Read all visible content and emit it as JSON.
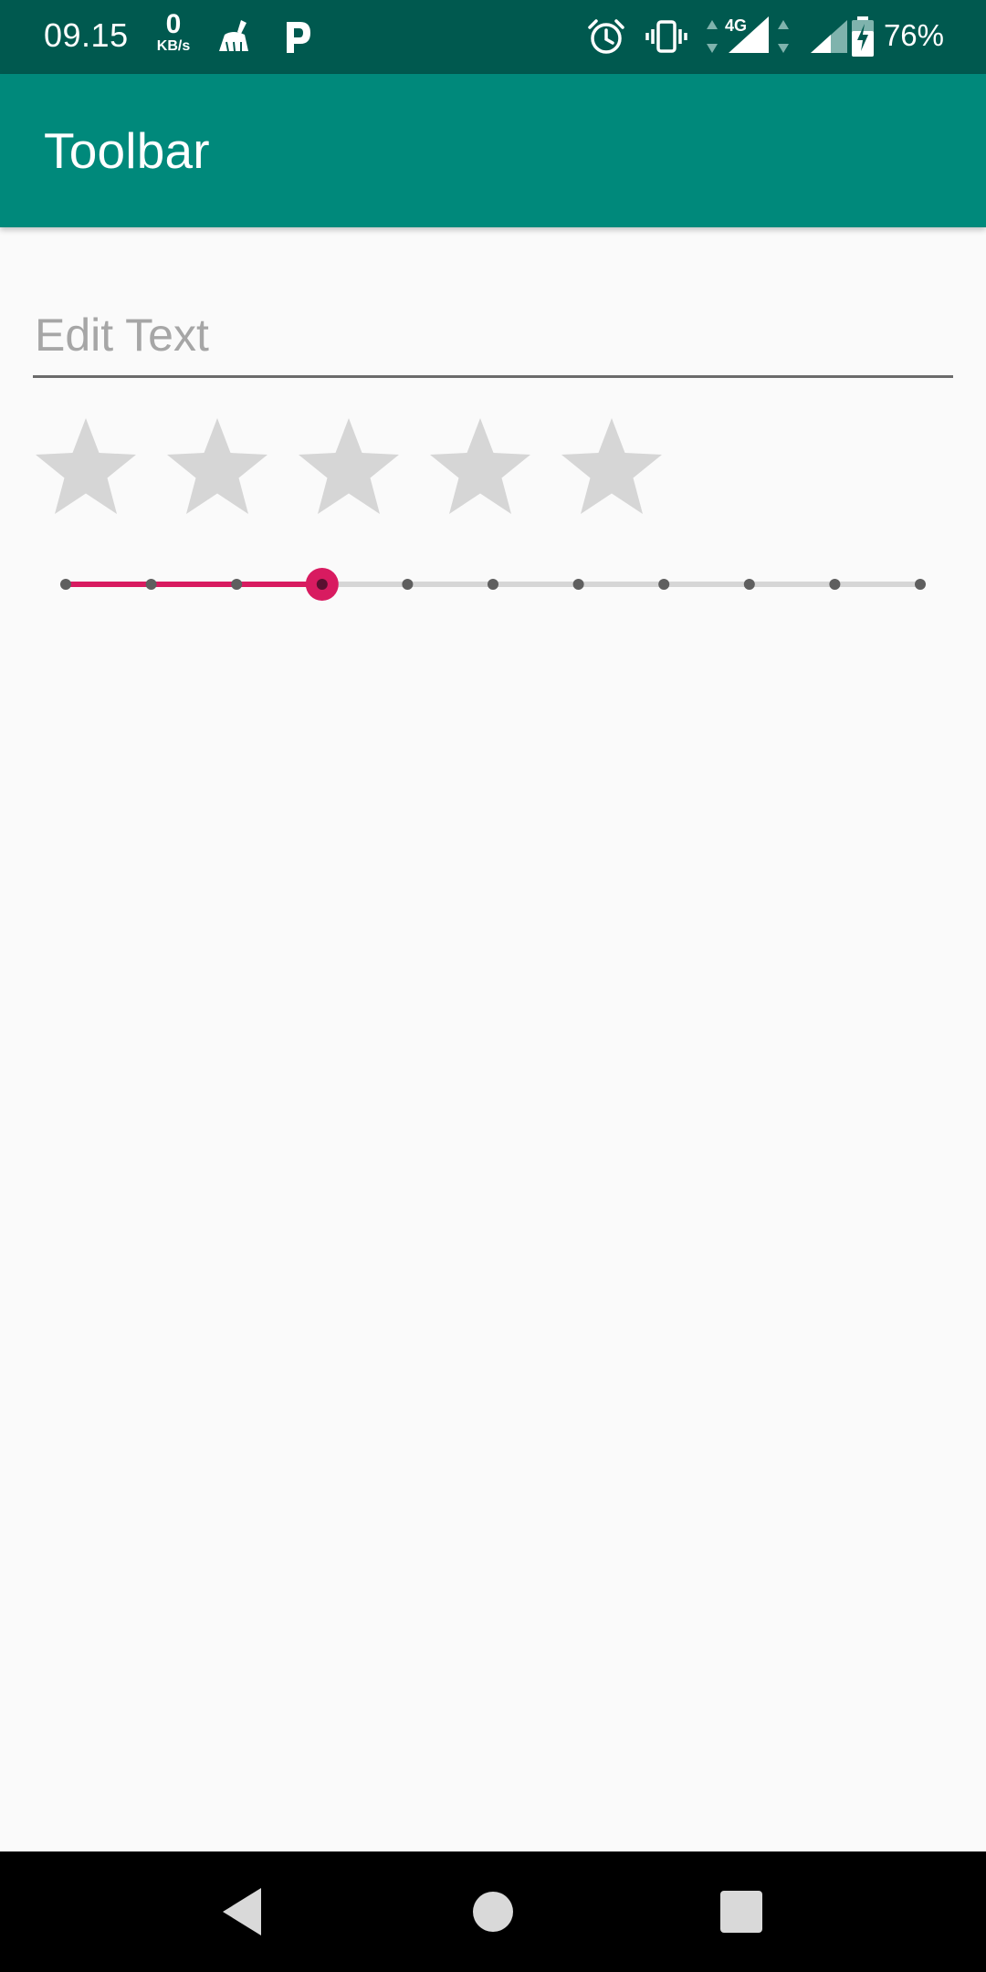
{
  "status_bar": {
    "time": "09.15",
    "net_speed_value": "0",
    "net_speed_unit": "KB/s",
    "network_type": "4G",
    "battery_percent": "76%",
    "icons": [
      "cleaner-broom-icon",
      "parking-p-icon",
      "alarm-clock-icon",
      "vibrate-icon",
      "data-arrows-icon",
      "signal-strength-icon",
      "signal-strength-secondary-icon",
      "battery-charging-icon"
    ]
  },
  "toolbar": {
    "title": "Toolbar"
  },
  "edit_text": {
    "value": "",
    "placeholder": "Edit Text"
  },
  "rating_bar": {
    "num_stars": 5,
    "rating": 0
  },
  "seek_bar": {
    "max": 10,
    "progress": 3,
    "ticks": 11
  },
  "nav_bar": {
    "buttons": [
      "back-icon",
      "home-icon",
      "recents-icon"
    ]
  },
  "colors": {
    "status_bar": "#00594f",
    "toolbar": "#00897b",
    "accent": "#d81b60",
    "star_empty": "#d6d6d6",
    "track_inactive": "#d6d6d6",
    "tick": "#5f5f5f",
    "background": "#fafafa"
  }
}
